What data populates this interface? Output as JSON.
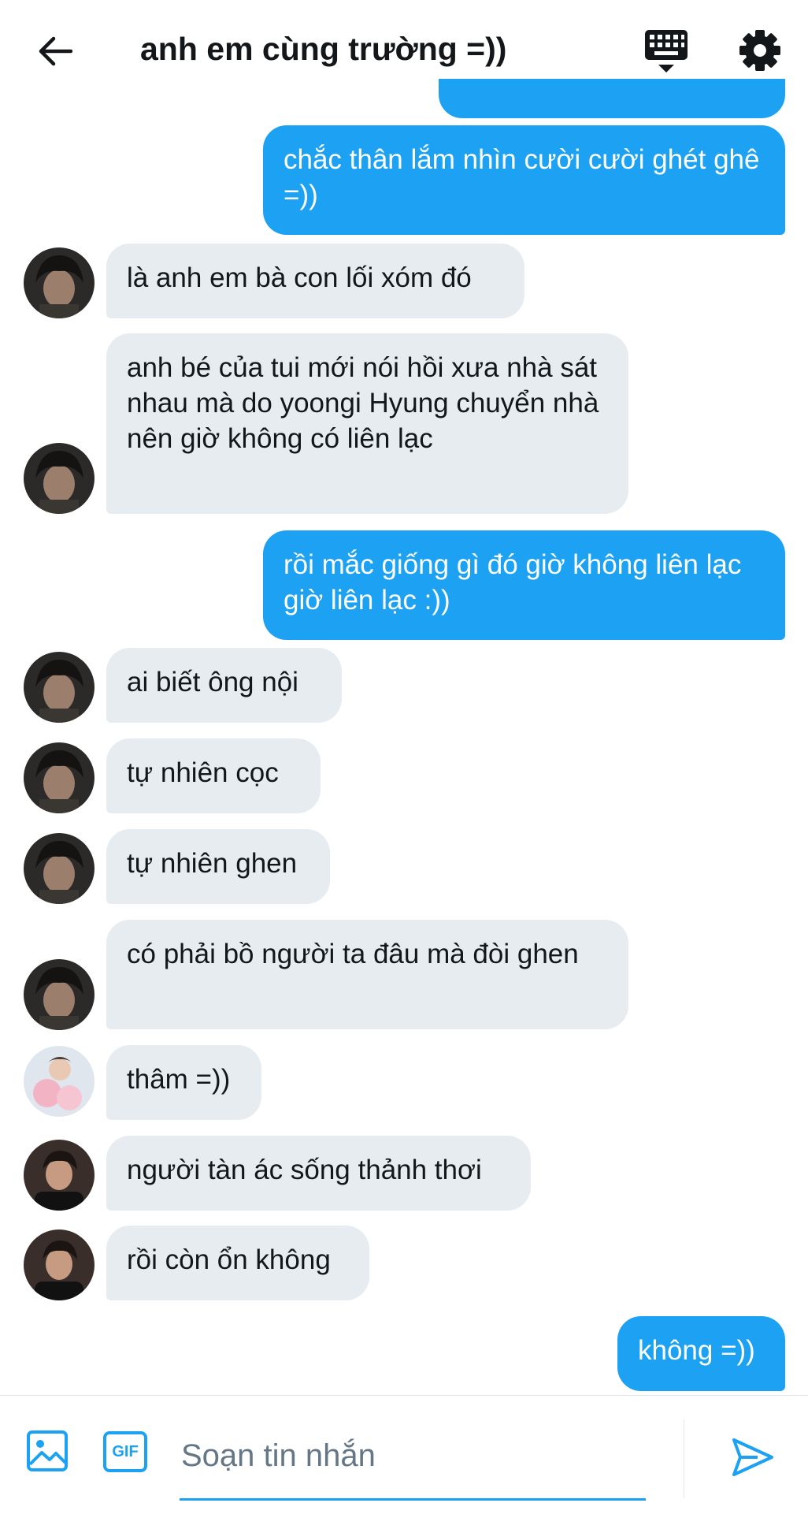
{
  "header": {
    "title": "anh em cùng trường =))",
    "back_icon": "arrow-left-icon",
    "keyboard_icon": "keyboard-icon",
    "settings_icon": "gear-icon"
  },
  "messages": [
    {
      "from": "me",
      "text": "chắc thân lắm nhìn cười cười ghét ghê =))"
    },
    {
      "from": "other",
      "avatar": "avatar-1",
      "text": "là anh em bà con lối xóm đó"
    },
    {
      "from": "other",
      "avatar": "avatar-1",
      "text": "anh bé của tui mới nói hồi xưa nhà sát nhau mà do yoongi Hyung chuyển nhà nên giờ không có liên lạc"
    },
    {
      "from": "me",
      "text": "rồi mắc giống gì đó giờ không liên lạc giờ liên lạc :))"
    },
    {
      "from": "other",
      "avatar": "avatar-1",
      "text": "ai biết ông nội"
    },
    {
      "from": "other",
      "avatar": "avatar-1",
      "text": "tự nhiên cọc"
    },
    {
      "from": "other",
      "avatar": "avatar-1",
      "text": "tự nhiên ghen"
    },
    {
      "from": "other",
      "avatar": "avatar-1",
      "text": "có phải bồ người ta đâu mà đòi ghen"
    },
    {
      "from": "other",
      "avatar": "avatar-2",
      "text": "thâm =))"
    },
    {
      "from": "other",
      "avatar": "avatar-3",
      "text": "người tàn ác sống thảnh thơi"
    },
    {
      "from": "other",
      "avatar": "avatar-3",
      "text": "rồi còn ổn không"
    },
    {
      "from": "me",
      "text": "không =))"
    }
  ],
  "composer": {
    "placeholder": "Soạn tin nhắn",
    "gif_label": "GIF",
    "image_icon": "image-icon",
    "send_icon": "send-icon"
  },
  "colors": {
    "accent": "#1da1f2",
    "incoming_bubble": "#e6ecf0",
    "text": "#14171a",
    "placeholder": "#657786"
  }
}
